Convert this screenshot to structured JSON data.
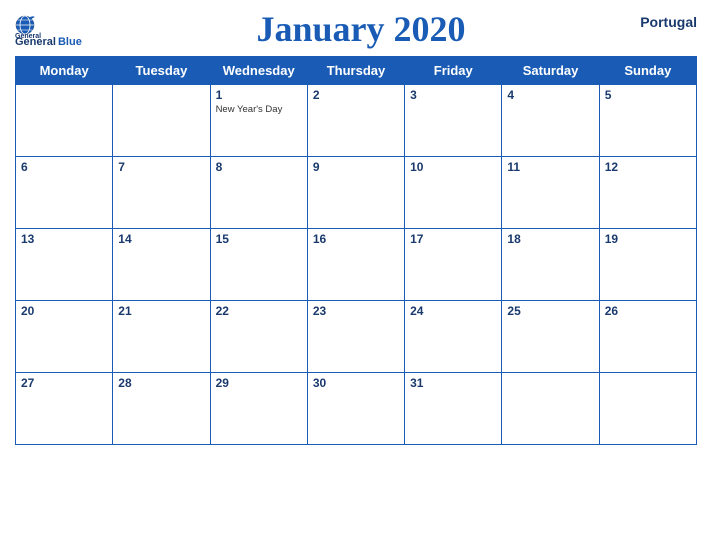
{
  "header": {
    "logo": {
      "line1": "General",
      "line2": "Blue"
    },
    "title": "January 2020",
    "country": "Portugal"
  },
  "weekdays": [
    "Monday",
    "Tuesday",
    "Wednesday",
    "Thursday",
    "Friday",
    "Saturday",
    "Sunday"
  ],
  "weeks": [
    [
      {
        "day": "",
        "empty": true
      },
      {
        "day": "",
        "empty": true
      },
      {
        "day": "1",
        "holiday": "New Year's Day"
      },
      {
        "day": "2"
      },
      {
        "day": "3"
      },
      {
        "day": "4"
      },
      {
        "day": "5"
      }
    ],
    [
      {
        "day": "6"
      },
      {
        "day": "7"
      },
      {
        "day": "8"
      },
      {
        "day": "9"
      },
      {
        "day": "10"
      },
      {
        "day": "11"
      },
      {
        "day": "12"
      }
    ],
    [
      {
        "day": "13"
      },
      {
        "day": "14"
      },
      {
        "day": "15"
      },
      {
        "day": "16"
      },
      {
        "day": "17"
      },
      {
        "day": "18"
      },
      {
        "day": "19"
      }
    ],
    [
      {
        "day": "20"
      },
      {
        "day": "21"
      },
      {
        "day": "22"
      },
      {
        "day": "23"
      },
      {
        "day": "24"
      },
      {
        "day": "25"
      },
      {
        "day": "26"
      }
    ],
    [
      {
        "day": "27"
      },
      {
        "day": "28"
      },
      {
        "day": "29"
      },
      {
        "day": "30"
      },
      {
        "day": "31"
      },
      {
        "day": "",
        "empty": true
      },
      {
        "day": "",
        "empty": true
      }
    ]
  ]
}
